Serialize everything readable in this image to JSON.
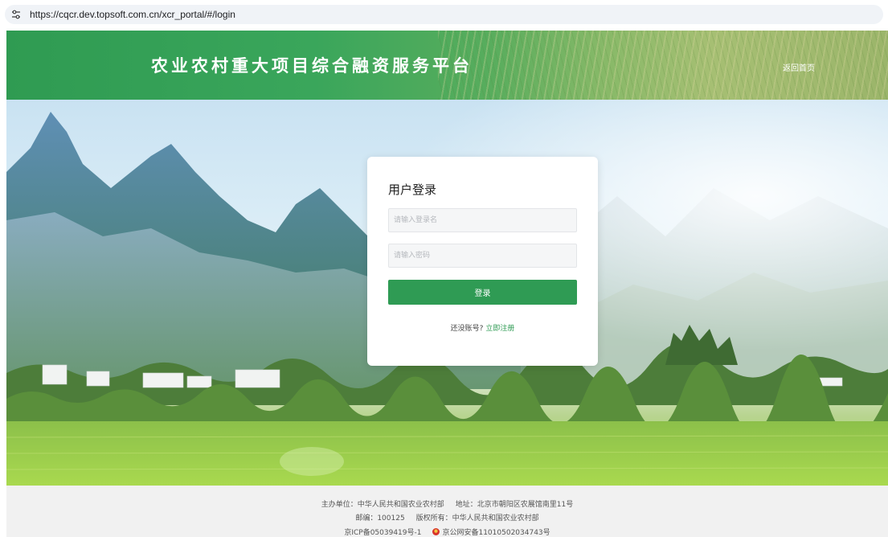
{
  "browser": {
    "url": "https://cqcr.dev.topsoft.com.cn/xcr_portal/#/login",
    "site_info_icon": "tune-icon"
  },
  "header": {
    "title": "农业农村重大项目综合融资服务平台",
    "home_link": "返回首页"
  },
  "login": {
    "title": "用户登录",
    "username_placeholder": "请输入登录名",
    "password_placeholder": "请输入密码",
    "submit_label": "登录",
    "no_account_text": "还没账号?",
    "register_link": "立即注册"
  },
  "footer": {
    "sponsor": "主办单位：中华人民共和国农业农村部",
    "address": "地址：北京市朝阳区农展馆南里11号",
    "postcode": "邮编：100125",
    "copyright": "版权所有：中华人民共和国农业农村部",
    "icp": "京ICP备05039419号-1",
    "police_record": "京公网安备11010502034743号",
    "police_icon": "police-badge-icon"
  },
  "colors": {
    "brand_green": "#2f9b54",
    "header_green": "#3aa65b",
    "footer_bg": "#f1f1f1"
  }
}
